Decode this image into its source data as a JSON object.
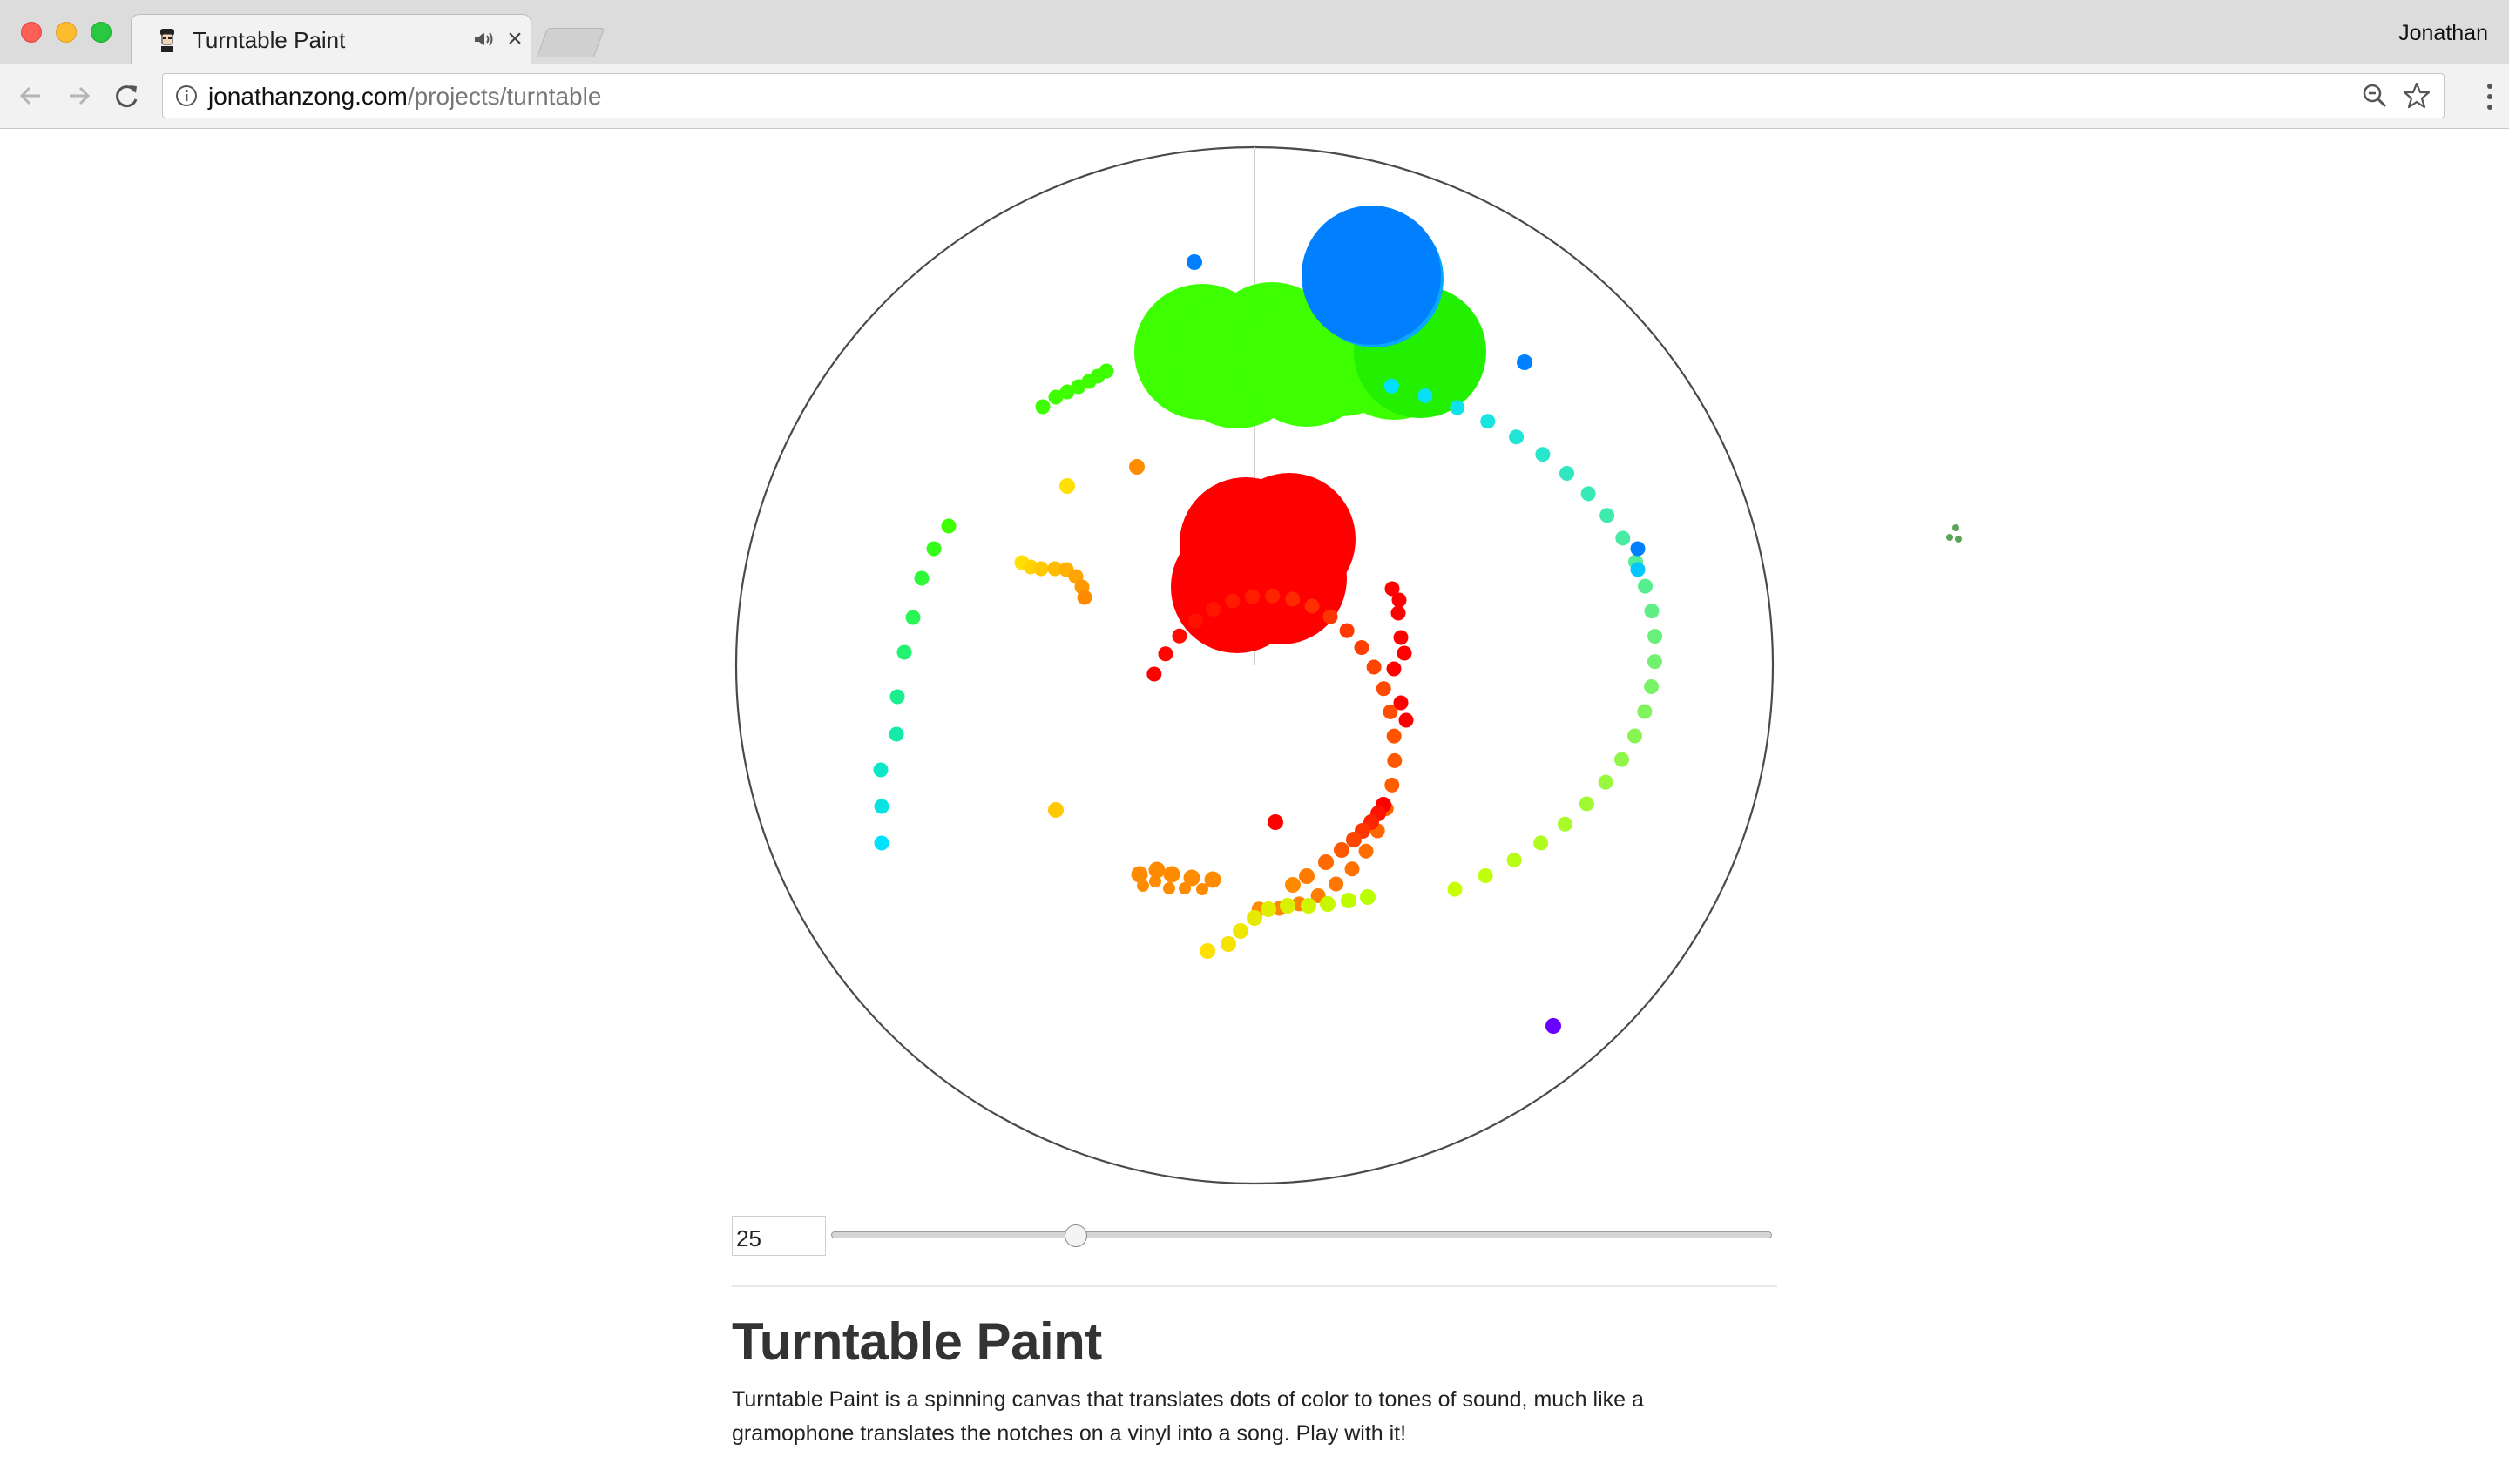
{
  "browser": {
    "tab_title": "Turntable Paint",
    "profile_name": "Jonathan",
    "url_domain": "jonathanzong.com",
    "url_path": "/projects/turntable"
  },
  "controls": {
    "value": "25",
    "slider_level": 0.26
  },
  "article": {
    "title": "Turntable Paint",
    "description": "Turntable Paint is a spinning canvas that translates dots of color to tones of sound, much like a gramophone translates the notches on a vinyl into a song. Play with it!"
  },
  "colors": {
    "red": "#ff0000",
    "green": "#3dff00",
    "blue": "#0080ff",
    "cyan": "#00e0ff",
    "orange": "#ff8c00",
    "yellow": "#ffe000",
    "purple": "#6a00ff"
  }
}
